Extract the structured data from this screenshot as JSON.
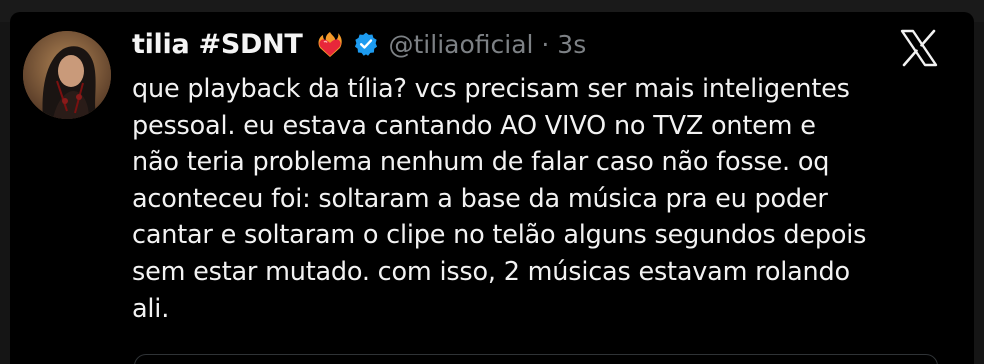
{
  "tweet": {
    "display_name": "tilia #SDNT",
    "handle_time": "@tiliaoficial · 3s",
    "lines": [
      "que playback da tília? vcs precisam ser mais inteligentes",
      "pessoal. eu estava cantando AO VIVO no TVZ ontem e",
      "não teria problema nenhum de falar caso não fosse. oq",
      "aconteceu foi: soltaram a base da música pra eu poder",
      "cantar e soltaram o clipe no telão alguns segundos depois",
      "sem estar mutado. com isso, 2 músicas estavam rolando",
      "ali."
    ]
  },
  "icons": {
    "emoji": "heart-on-fire-icon",
    "verified": "verified-badge-icon",
    "brand": "x-logo-icon"
  },
  "colors": {
    "background": "#000000",
    "text": "#f2f2f2",
    "secondary": "#7d8185",
    "verified": "#1d9bf0"
  }
}
